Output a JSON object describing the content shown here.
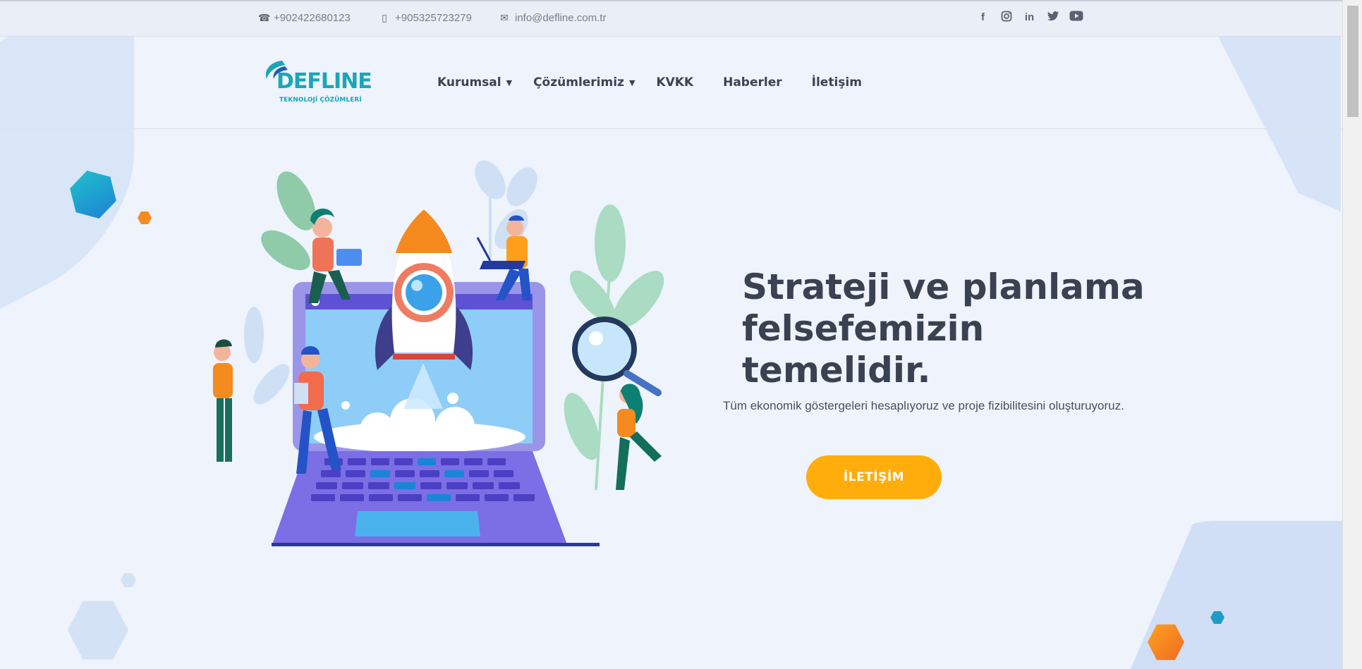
{
  "topbar": {
    "phone1": "+902422680123",
    "phone2": "+905325723279",
    "email": "info@defline.com.tr",
    "social": [
      "facebook-icon",
      "instagram-icon",
      "linkedin-icon",
      "twitter-icon",
      "youtube-icon"
    ]
  },
  "logo": {
    "name": "DEFLINE",
    "tagline": "TEKNOLOJİ ÇÖZÜMLERİ"
  },
  "nav": {
    "items": [
      {
        "label": "Kurumsal",
        "dropdown": true
      },
      {
        "label": "Çözümlerimiz",
        "dropdown": true
      },
      {
        "label": "KVKK",
        "dropdown": false
      },
      {
        "label": "Haberler",
        "dropdown": false
      },
      {
        "label": "İletişim",
        "dropdown": false
      }
    ]
  },
  "hero": {
    "title_line1": "Strateji ve planlama",
    "title_line2": "felsefemizin temelidir.",
    "subtitle": "Tüm ekonomik göstergeleri hesaplıyoruz ve proje fizibilitesini oluşturuyoruz.",
    "cta_label": "İLETİŞİM"
  },
  "colors": {
    "accent": "#ffad0b",
    "brand_teal": "#1aa6b7",
    "brand_blue": "#1f5fa8",
    "background": "#eef3fc"
  }
}
